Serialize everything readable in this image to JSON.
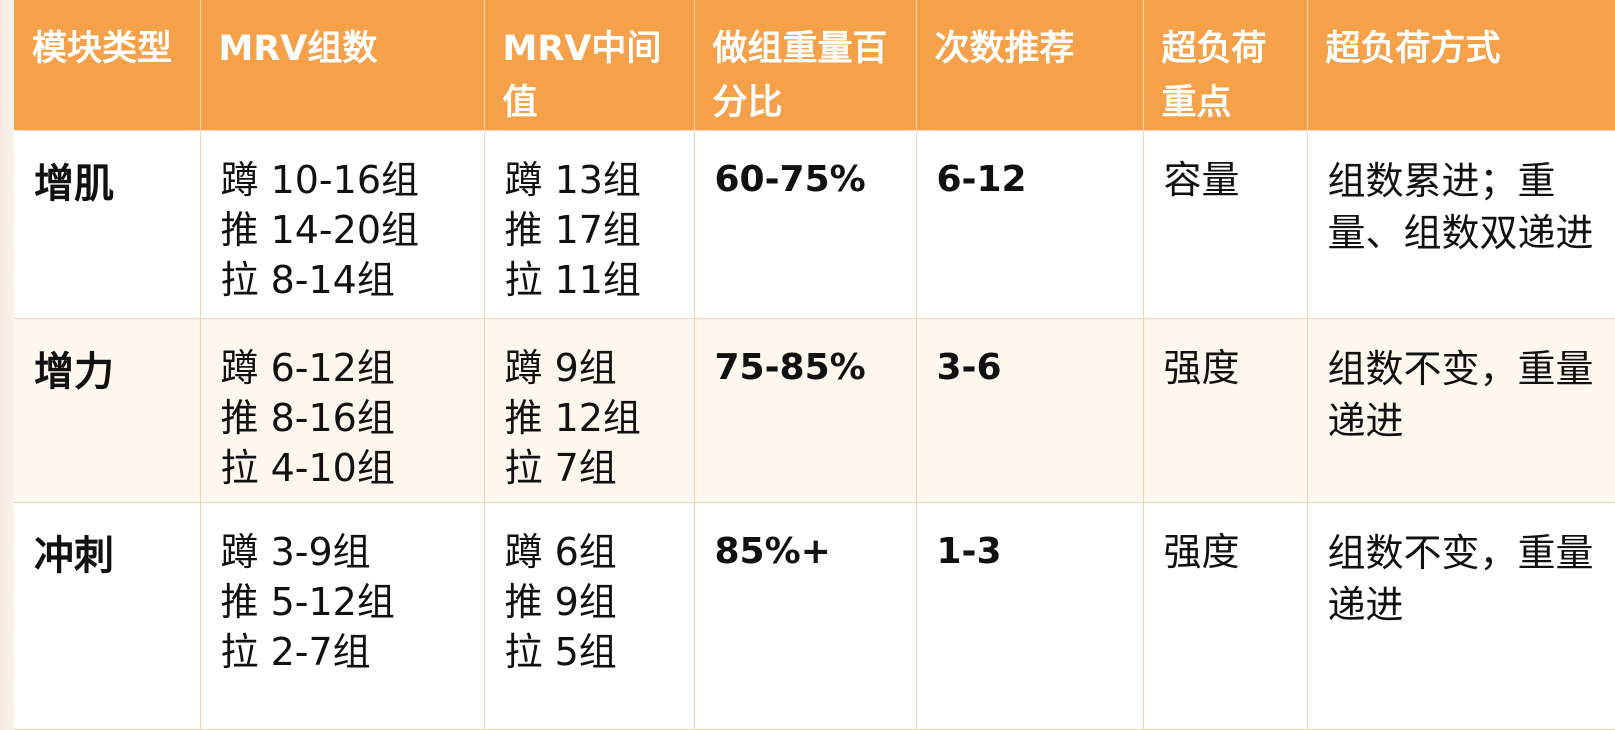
{
  "headers": [
    "模块类型",
    "MRV组数",
    "MRV中间值",
    "做组重量百分比",
    "次数推荐",
    "超负荷重点",
    "超负荷方式"
  ],
  "rows": [
    {
      "type": "增肌",
      "mrv_sets": [
        "蹲 10-16组",
        "推 14-20组",
        "拉 8-14组"
      ],
      "mrv_mid": [
        "蹲 13组",
        "推 17组",
        "拉 11组"
      ],
      "weight_pct": "60-75%",
      "reps": "6-12",
      "focus": "容量",
      "method": "组数累进；重量、组数双递进"
    },
    {
      "type": "增力",
      "mrv_sets": [
        "蹲 6-12组",
        "推 8-16组",
        "拉 4-10组"
      ],
      "mrv_mid": [
        "蹲 9组",
        "推 12组",
        "拉 7组"
      ],
      "weight_pct": "75-85%",
      "reps": "3-6",
      "focus": "强度",
      "method": "组数不变，重量递进"
    },
    {
      "type": "冲刺",
      "mrv_sets": [
        "蹲 3-9组",
        "推 5-12组",
        "拉 2-7组"
      ],
      "mrv_mid": [
        "蹲 6组",
        "推 9组",
        "拉 5组"
      ],
      "weight_pct": "85%+",
      "reps": "1-3",
      "focus": "强度",
      "method": "组数不变，重量递进"
    }
  ],
  "colors": {
    "header_bg": "#f5a14a",
    "header_text": "#ffffff",
    "row_alt_bg": "#fef7ee",
    "border": "#f3d2ad"
  }
}
